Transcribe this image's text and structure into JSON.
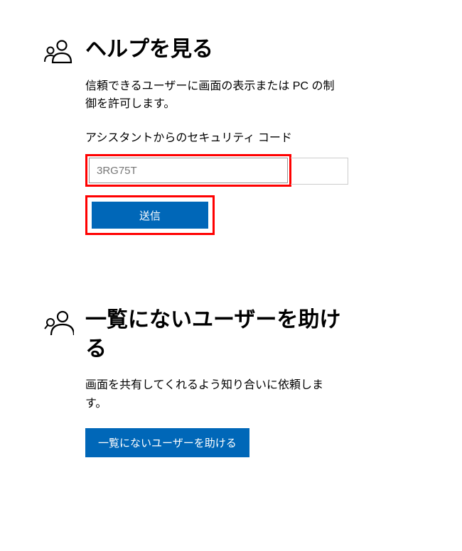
{
  "get_help": {
    "title": "ヘルプを見る",
    "description": "信頼できるユーザーに画面の表示または PC の制御を許可します。",
    "code_label": "アシスタントからのセキュリティ コード",
    "code_placeholder": "3RG75T",
    "submit_label": "送信"
  },
  "give_help": {
    "title": "一覧にないユーザーを助ける",
    "description": "画面を共有してくれるよう知り合いに依頼します。",
    "button_label": "一覧にないユーザーを助ける"
  },
  "colors": {
    "accent": "#0067b8",
    "highlight": "#ff0000"
  }
}
